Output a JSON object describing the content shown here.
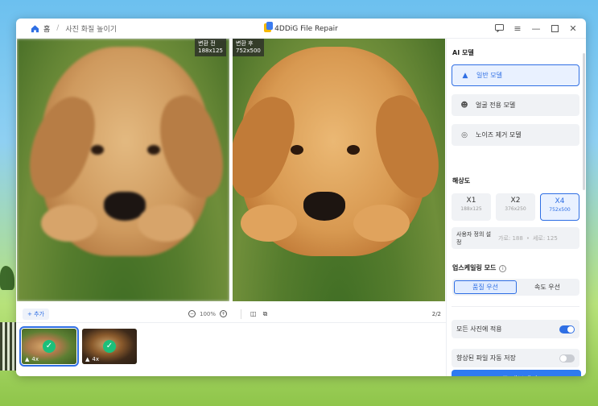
{
  "titlebar": {
    "home_label": "홈",
    "breadcrumb_current": "사진 화질 높이기",
    "app_title": "4DDiG File Repair"
  },
  "preview": {
    "before_label": "변환 전",
    "before_size": "188x125",
    "after_label": "변환 후",
    "after_size": "752x500"
  },
  "toolbar": {
    "add_label": "+ 추가",
    "zoom_value": "100%",
    "page_indicator": "2/2"
  },
  "thumbnails": [
    {
      "scale": "4x",
      "active": true
    },
    {
      "scale": "4x",
      "active": false
    }
  ],
  "panel": {
    "ai_model_title": "AI 모델",
    "models": [
      {
        "label": "일반 모델",
        "icon": "image-icon",
        "selected": true
      },
      {
        "label": "얼굴 전용 모델",
        "icon": "face-icon",
        "selected": false
      },
      {
        "label": "노이즈 제거 모델",
        "icon": "noise-icon",
        "selected": false
      }
    ],
    "resolution_title": "해상도",
    "resolutions": [
      {
        "scale": "X1",
        "size": "188x125",
        "selected": false
      },
      {
        "scale": "X2",
        "size": "376x250",
        "selected": false
      },
      {
        "scale": "X4",
        "size": "752x500",
        "selected": true
      }
    ],
    "custom_label": "사용자 정의 설정",
    "custom_width": "가로: 188",
    "custom_height": "세로: 125",
    "upscale_title": "업스케일링 모드",
    "upscale_modes": [
      {
        "label": "품질 우선",
        "selected": true
      },
      {
        "label": "속도 우선",
        "selected": false
      }
    ],
    "apply_all_label": "모든 사진에 적용",
    "apply_all_on": true,
    "autosave_label": "향상된 파일 자동 저장",
    "autosave_on": false,
    "export_label": "모두 내보내기"
  },
  "colors": {
    "accent": "#2f6fe4",
    "export_button": "#2f7bf0",
    "success": "#1bbf7a"
  }
}
